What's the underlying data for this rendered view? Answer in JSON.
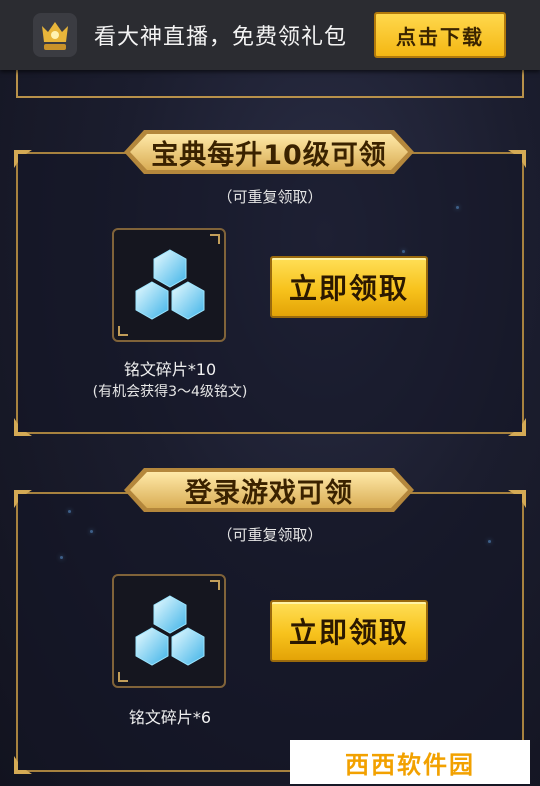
{
  "topbar": {
    "promo_text": "看大神直播，免费领礼包",
    "download_label": "点击下载"
  },
  "section1": {
    "title": "宝典每升10级可领",
    "note": "（可重复领取）",
    "item_name": "铭文碎片*10",
    "item_sub": "(有机会获得3～4级铭文)",
    "claim_label": "立即领取"
  },
  "section2": {
    "title": "登录游戏可领",
    "note": "（可重复领取）",
    "item_name": "铭文碎片*6",
    "claim_label": "立即领取"
  },
  "watermark": {
    "text": "西西软件园"
  },
  "colors": {
    "gold": "#f7c21c",
    "frame": "#a7823f",
    "background": "#1b1d2e"
  }
}
